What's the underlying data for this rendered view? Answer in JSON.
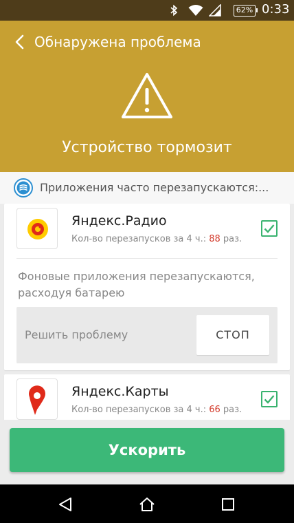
{
  "status_bar": {
    "battery": "62%",
    "time": "0:33",
    "icons": [
      "bluetooth-icon",
      "wifi-icon",
      "signal-icon",
      "battery-icon"
    ]
  },
  "header": {
    "title": "Обнаружена проблема",
    "headline": "Устройство тормозит",
    "background": "#c7a032",
    "icons": [
      "back-arrow-icon",
      "warning-icon"
    ]
  },
  "subheader": {
    "text": "Приложения часто перезапускаются:...",
    "icon": "shield-icon"
  },
  "apps": [
    {
      "name": "Яндекс.Радио",
      "restarts_prefix": "Кол-во перезапусков за 4 ч.: ",
      "restarts_count": "88",
      "restarts_suffix": " раз.",
      "checked": true,
      "icon": "yandex-radio-icon",
      "reason": "Фоновые приложения перезапускаются, расходуя батарею",
      "fix_label": "Решить проблему",
      "stop_label": "СТОП"
    },
    {
      "name": "Яндекс.Карты",
      "restarts_prefix": "Кол-во перезапусков за 4 ч.: ",
      "restarts_count": "66",
      "restarts_suffix": " раз.",
      "checked": true,
      "icon": "yandex-maps-icon"
    }
  ],
  "boost_button": {
    "label": "Ускорить",
    "color": "#3cb878"
  },
  "nav_bar": {
    "icons": [
      "nav-back-icon",
      "nav-home-icon",
      "nav-recents-icon"
    ]
  }
}
